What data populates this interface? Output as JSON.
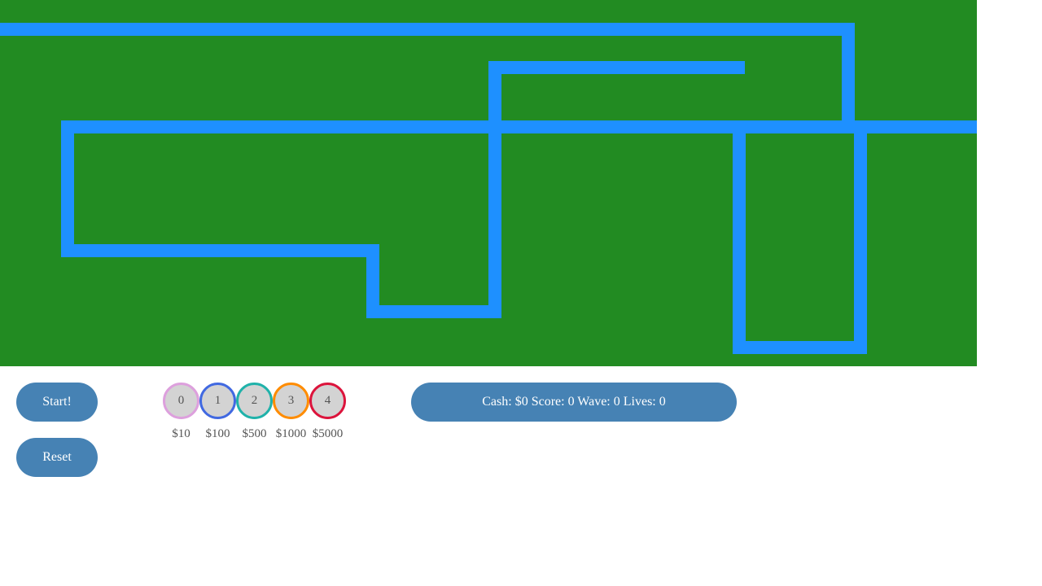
{
  "buttons": {
    "start": "Start!",
    "reset": "Reset"
  },
  "towers": [
    {
      "id": "0",
      "price": "$10",
      "color": "#DDA0DD"
    },
    {
      "id": "1",
      "price": "$100",
      "color": "#4169E1"
    },
    {
      "id": "2",
      "price": "$500",
      "color": "#20B2AA"
    },
    {
      "id": "3",
      "price": "$1000",
      "color": "#FF8C00"
    },
    {
      "id": "4",
      "price": "$5000",
      "color": "#DC143C"
    }
  ],
  "status": {
    "cash_label": "Cash:",
    "cash_value": "$0",
    "score_label": "Score:",
    "score_value": "0",
    "wave_label": "Wave:",
    "wave_value": "0",
    "lives_label": "Lives:",
    "lives_value": "0"
  },
  "colors": {
    "board": "#228B22",
    "path": "#1E90FF",
    "button": "#4682B4"
  }
}
